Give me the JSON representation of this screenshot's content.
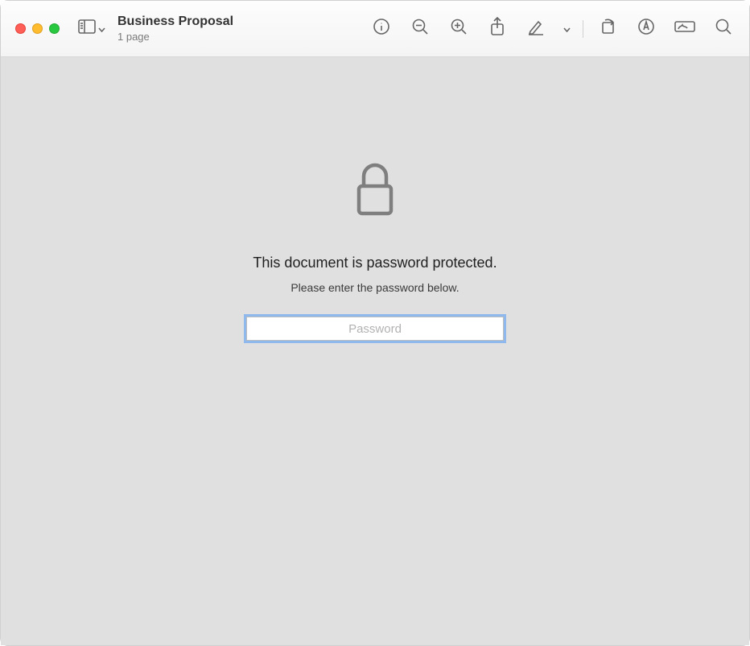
{
  "header": {
    "title": "Business Proposal",
    "subtitle": "1 page"
  },
  "content": {
    "headline": "This document is password protected.",
    "subline": "Please enter the password below.",
    "password_placeholder": "Password",
    "password_value": ""
  }
}
